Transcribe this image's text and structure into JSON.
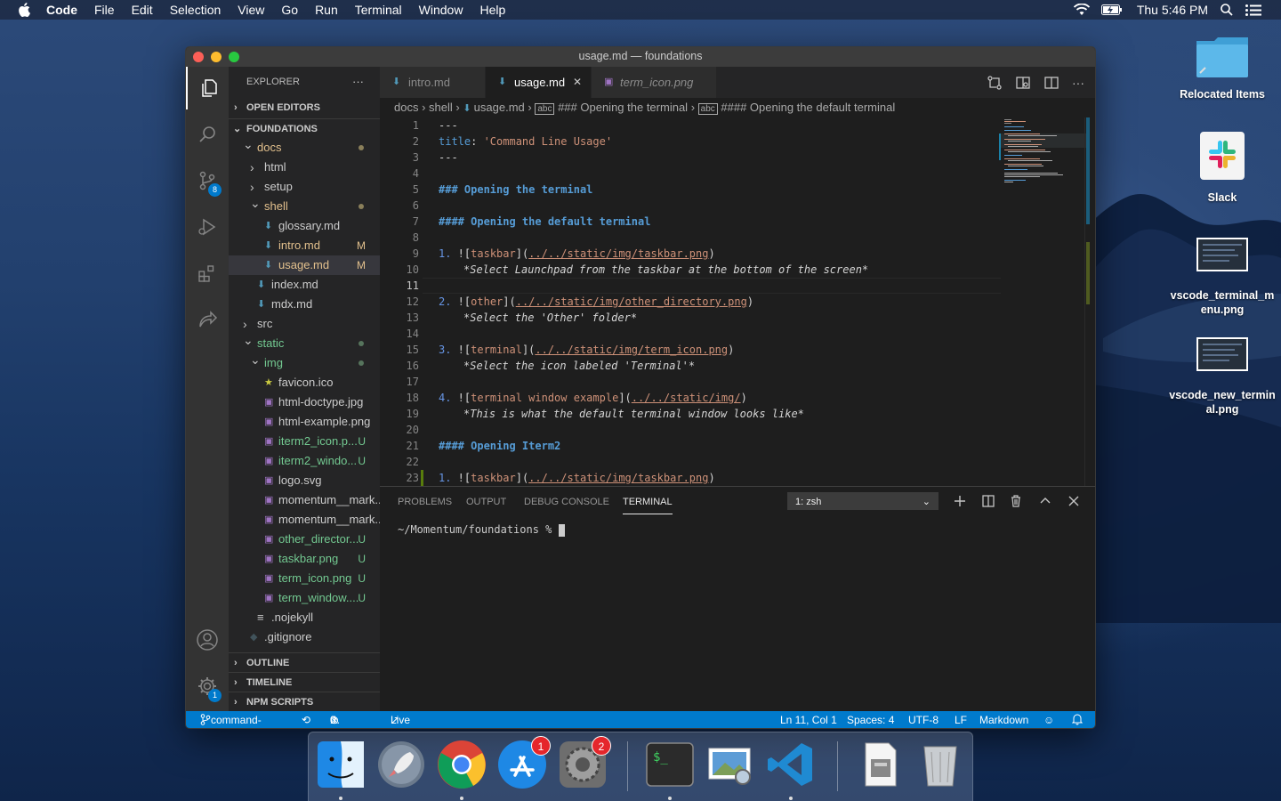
{
  "menubar": {
    "app": "Code",
    "items": [
      "File",
      "Edit",
      "Selection",
      "View",
      "Go",
      "Run",
      "Terminal",
      "Window",
      "Help"
    ],
    "clock": "Thu 5:46 PM"
  },
  "desktop": {
    "icons": [
      {
        "label": "Relocated Items"
      },
      {
        "label": "Slack"
      },
      {
        "label": "vscode_terminal_menu.png"
      },
      {
        "label": "vscode_new_terminal.png"
      }
    ]
  },
  "window": {
    "title": "usage.md — foundations"
  },
  "activity": {
    "scm_badge": "8",
    "settings_badge": "1"
  },
  "explorer": {
    "title": "EXPLORER",
    "more": "···",
    "open_editors": "OPEN EDITORS",
    "root": "FOUNDATIONS",
    "rows": [
      {
        "label": "docs",
        "type": "folder-open",
        "depth": 1,
        "color": "#e2c08d",
        "dot": true
      },
      {
        "label": "html",
        "type": "folder",
        "depth": 2,
        "color": "#cccccc"
      },
      {
        "label": "setup",
        "type": "folder",
        "depth": 2,
        "color": "#cccccc"
      },
      {
        "label": "shell",
        "type": "folder-open",
        "depth": 2,
        "color": "#e2c08d",
        "dot": true
      },
      {
        "label": "glossary.md",
        "type": "md",
        "depth": 3,
        "color": "#cccccc"
      },
      {
        "label": "intro.md",
        "type": "md",
        "depth": 3,
        "color": "#e2c08d",
        "status": "M"
      },
      {
        "label": "usage.md",
        "type": "md",
        "depth": 3,
        "color": "#e2c08d",
        "status": "M",
        "selected": true
      },
      {
        "label": "index.md",
        "type": "md",
        "depth": 2,
        "color": "#cccccc"
      },
      {
        "label": "mdx.md",
        "type": "md",
        "depth": 2,
        "color": "#cccccc"
      },
      {
        "label": "src",
        "type": "folder",
        "depth": 1,
        "color": "#cccccc"
      },
      {
        "label": "static",
        "type": "folder-open",
        "depth": 1,
        "color": "#73c991",
        "dot": true,
        "dotcolor": "#56745c"
      },
      {
        "label": "img",
        "type": "folder-open",
        "depth": 2,
        "color": "#73c991",
        "dot": true,
        "dotcolor": "#56745c"
      },
      {
        "label": "favicon.ico",
        "type": "star",
        "depth": 3,
        "color": "#cccccc"
      },
      {
        "label": "html-doctype.jpg",
        "type": "img",
        "depth": 3,
        "color": "#cccccc"
      },
      {
        "label": "html-example.png",
        "type": "img",
        "depth": 3,
        "color": "#cccccc"
      },
      {
        "label": "iterm2_icon.p...",
        "type": "img",
        "depth": 3,
        "color": "#73c991",
        "status": "U"
      },
      {
        "label": "iterm2_windo...",
        "type": "img",
        "depth": 3,
        "color": "#73c991",
        "status": "U"
      },
      {
        "label": "logo.svg",
        "type": "img",
        "depth": 3,
        "color": "#cccccc"
      },
      {
        "label": "momentum__mark...",
        "type": "img",
        "depth": 3,
        "color": "#cccccc"
      },
      {
        "label": "momentum__mark...",
        "type": "img",
        "depth": 3,
        "color": "#cccccc"
      },
      {
        "label": "other_director...",
        "type": "img",
        "depth": 3,
        "color": "#73c991",
        "status": "U"
      },
      {
        "label": "taskbar.png",
        "type": "img",
        "depth": 3,
        "color": "#73c991",
        "status": "U"
      },
      {
        "label": "term_icon.png",
        "type": "img",
        "depth": 3,
        "color": "#73c991",
        "status": "U"
      },
      {
        "label": "term_window....",
        "type": "img",
        "depth": 3,
        "color": "#73c991",
        "status": "U"
      },
      {
        "label": ".nojekyll",
        "type": "lines",
        "depth": 2,
        "color": "#cccccc"
      },
      {
        "label": ".gitignore",
        "type": "git",
        "depth": 1,
        "color": "#cccccc"
      }
    ],
    "outline": "OUTLINE",
    "timeline": "TIMELINE",
    "npm": "NPM SCRIPTS"
  },
  "tabs": [
    {
      "label": "intro.md",
      "active": false,
      "italic": false
    },
    {
      "label": "usage.md",
      "active": true,
      "italic": false,
      "close": "✕"
    },
    {
      "label": "term_icon.png",
      "active": false,
      "italic": true
    }
  ],
  "breadcrumb": [
    "docs",
    "shell",
    "usage.md",
    "### Opening the terminal",
    "#### Opening the default terminal"
  ],
  "code": {
    "line_numbers": [
      "1",
      "2",
      "3",
      "4",
      "5",
      "6",
      "7",
      "8",
      "9",
      "10",
      "11",
      "12",
      "13",
      "14",
      "15",
      "16",
      "17",
      "18",
      "19",
      "20",
      "21",
      "22",
      "23"
    ],
    "l1": "---",
    "l2k": "title",
    "l2c": ": ",
    "l2s": "'Command Line Usage'",
    "l3": "---",
    "l5": "### Opening the terminal",
    "l7": "#### Opening the default terminal",
    "l9n": "1.",
    "l9a": " ![",
    "l9t": "taskbar",
    "l9b": "](",
    "l9u": "../../static/img/taskbar.png",
    "l9e": ")",
    "l10": "*Select Launchpad from the taskbar at the bottom of the screen*",
    "l12n": "2.",
    "l12a": " ![",
    "l12t": "other",
    "l12b": "](",
    "l12u": "../../static/img/other_directory.png",
    "l12e": ")",
    "l13": "*Select the 'Other' folder*",
    "l15n": "3.",
    "l15a": " ![",
    "l15t": "terminal",
    "l15b": "](",
    "l15u": "../../static/img/term_icon.png",
    "l15e": ")",
    "l16": "*Select the icon labeled 'Terminal'*",
    "l18n": "4.",
    "l18a": " ![",
    "l18t": "terminal window example",
    "l18b": "](",
    "l18u": "../../static/img/",
    "l18e": ")",
    "l19": "*This is what the default terminal window looks like*",
    "l21": "#### Opening Iterm2",
    "l23n": "1.",
    "l23a": " ![",
    "l23t": "taskbar",
    "l23b": "](",
    "l23u": "../../static/img/taskbar.png",
    "l23e": ")"
  },
  "panel": {
    "tabs": [
      "PROBLEMS",
      "OUTPUT",
      "DEBUG CONSOLE",
      "TERMINAL"
    ],
    "terminal_select": "1: zsh",
    "prompt": "~/Momentum/foundations % "
  },
  "status": {
    "branch": "command-line*",
    "errors": "0",
    "warnings": "0",
    "live_share": "Live Share",
    "position": "Ln 11, Col 1",
    "spaces": "Spaces: 4",
    "encoding": "UTF-8",
    "eol": "LF",
    "language": "Markdown"
  },
  "dock": {
    "appstore_badge": "1",
    "prefs_badge": "2"
  }
}
